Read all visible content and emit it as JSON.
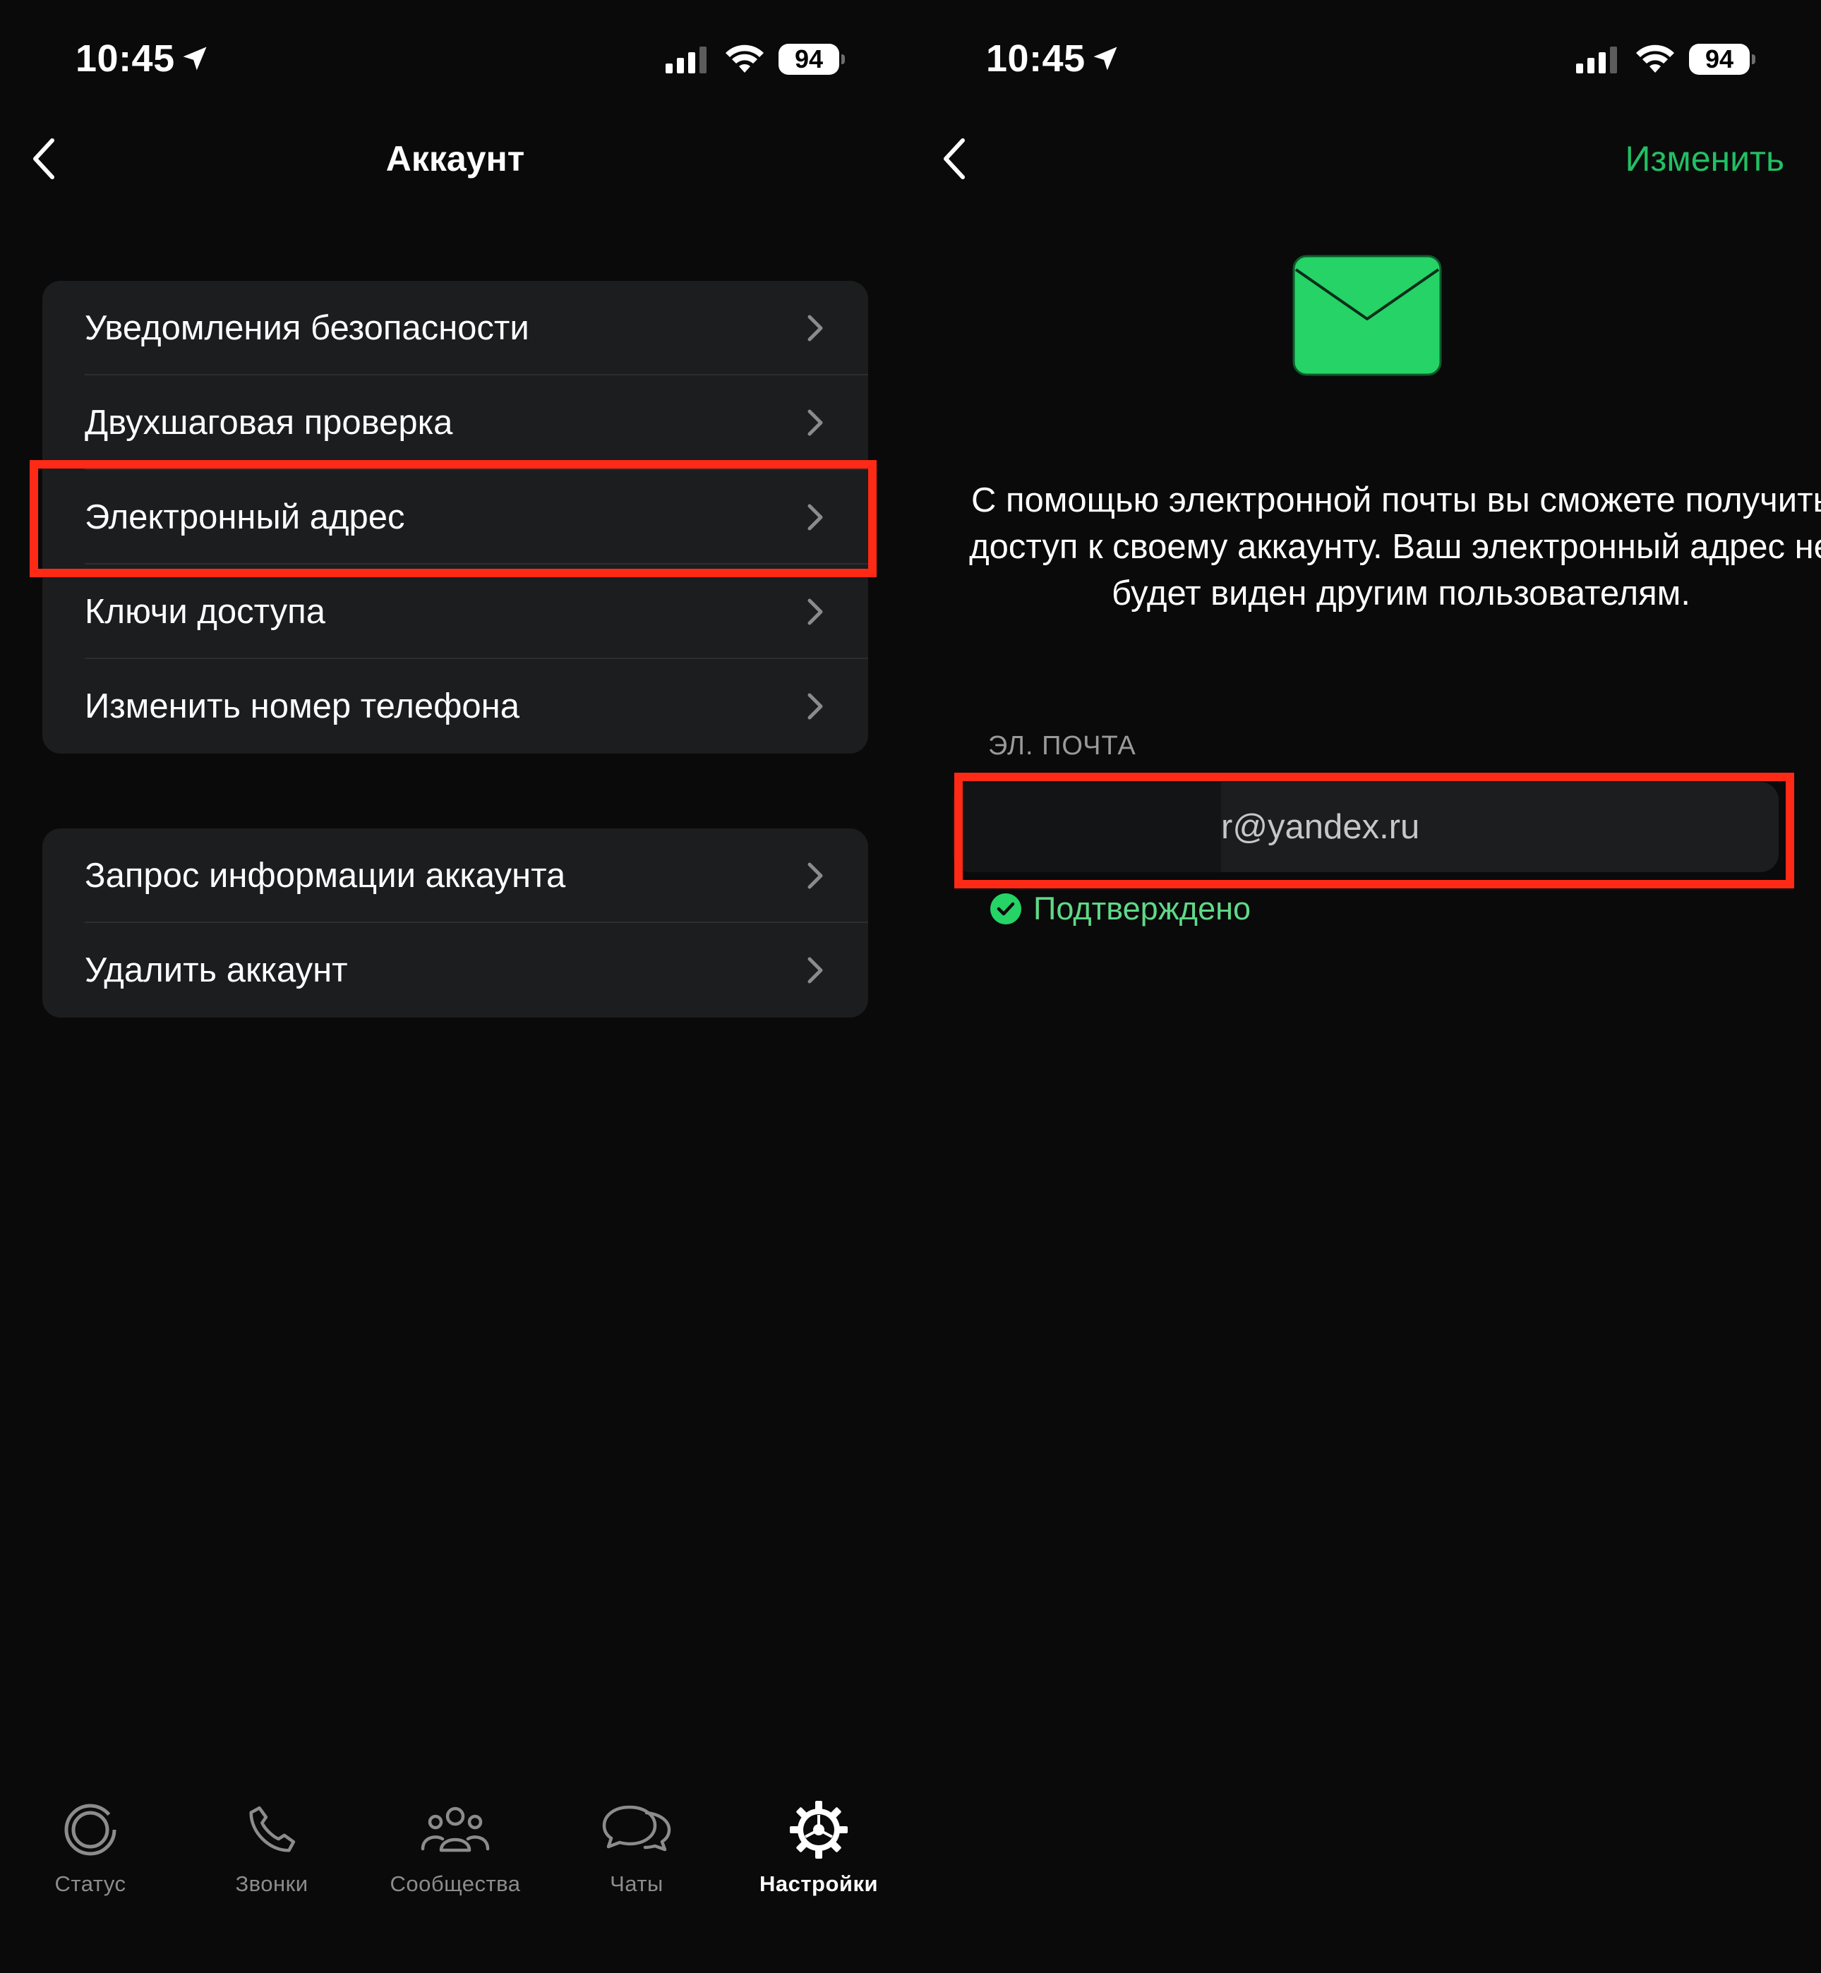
{
  "status_bar": {
    "time": "10:45",
    "battery": "94"
  },
  "left": {
    "title": "Аккаунт",
    "group1": [
      {
        "label": "Уведомления безопасности"
      },
      {
        "label": "Двухшаговая проверка"
      },
      {
        "label": "Электронный адрес"
      },
      {
        "label": "Ключи доступа"
      },
      {
        "label": "Изменить номер телефона"
      }
    ],
    "group2": [
      {
        "label": "Запрос информации аккаунта"
      },
      {
        "label": "Удалить аккаунт"
      }
    ],
    "tabs": [
      {
        "label": "Статус",
        "icon": "status-icon"
      },
      {
        "label": "Звонки",
        "icon": "phone-icon"
      },
      {
        "label": "Сообщества",
        "icon": "communities-icon"
      },
      {
        "label": "Чаты",
        "icon": "chats-icon"
      },
      {
        "label": "Настройки",
        "icon": "settings-gear-icon",
        "active": true
      }
    ]
  },
  "right": {
    "edit_label": "Изменить",
    "description": "С помощью электронной почты вы сможете получить доступ к своему аккаунту. Ваш электронный адрес не будет виден другим пользователям.",
    "section_label": "ЭЛ. ПОЧТА",
    "email_visible": "r@yandex.ru",
    "verified_label": "Подтверждено"
  },
  "colors": {
    "background": "#0a0a0a",
    "cell": "#1c1d1e",
    "accent_green": "#21c063",
    "highlight_red": "#ff2a16",
    "verified_green": "#5fd988"
  }
}
